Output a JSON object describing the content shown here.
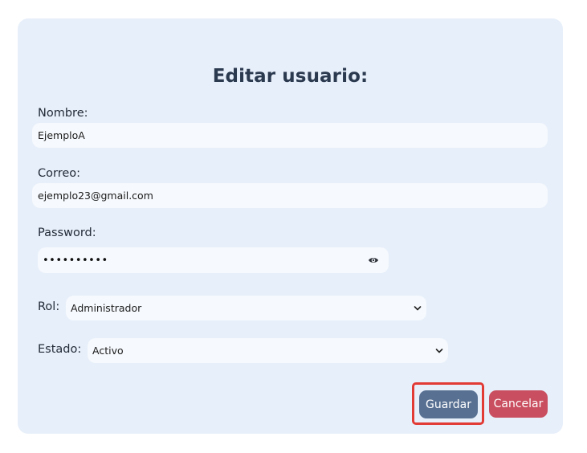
{
  "form": {
    "title": "Editar usuario:",
    "name": {
      "label": "Nombre:",
      "value": "EjemploA"
    },
    "email": {
      "label": "Correo:",
      "value": "ejemplo23@gmail.com"
    },
    "password": {
      "label": "Password:",
      "masked_value": "••••••••••",
      "toggle_icon": "eye-icon"
    },
    "role": {
      "label": "Rol:",
      "selected": "Administrador"
    },
    "status": {
      "label": "Estado:",
      "selected": "Activo"
    },
    "buttons": {
      "save": "Guardar",
      "cancel": "Cancelar"
    }
  },
  "colors": {
    "card_bg": "#e7effa",
    "save_button": "#587193",
    "cancel_button": "#c94e5f",
    "highlight_outline": "#e23a35"
  }
}
